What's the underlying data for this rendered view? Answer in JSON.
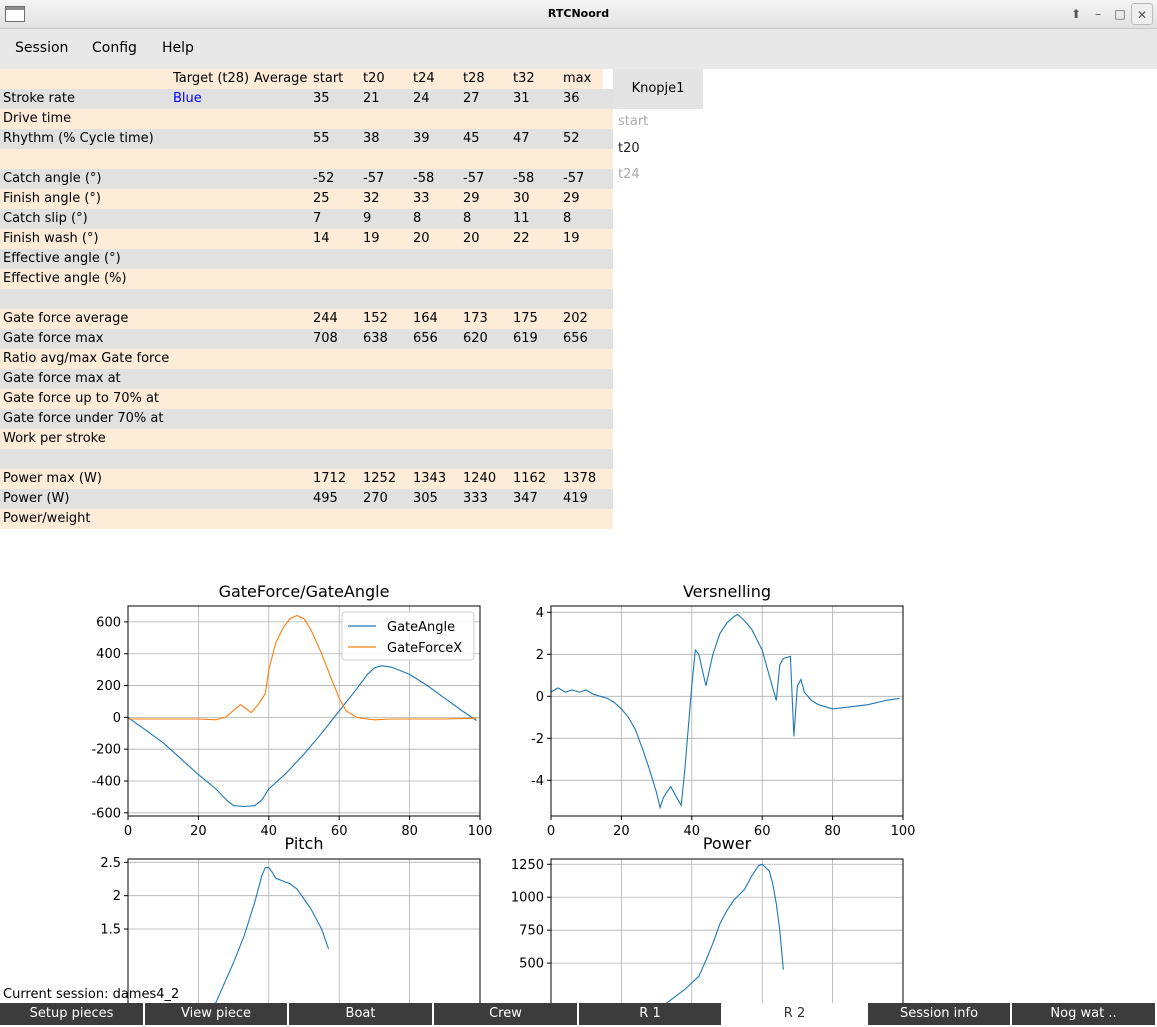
{
  "window": {
    "title": "RTCNoord"
  },
  "menu": [
    "Session",
    "Config",
    "Help"
  ],
  "table": {
    "header": {
      "target": "Target (t28)",
      "average": "Average",
      "cols": [
        "start",
        "t20",
        "t24",
        "t28",
        "t32",
        "max"
      ]
    },
    "rows": [
      {
        "label": "Stroke rate",
        "target": "Blue",
        "values": [
          "35",
          "21",
          "24",
          "27",
          "31",
          "36"
        ]
      },
      {
        "label": "Drive time",
        "target": "",
        "values": []
      },
      {
        "label": "Rhythm (% Cycle time)",
        "target": "",
        "values": [
          "55",
          "38",
          "39",
          "45",
          "47",
          "52"
        ]
      },
      {
        "label": "",
        "target": "",
        "values": []
      },
      {
        "label": "Catch angle (°)",
        "target": "",
        "values": [
          "-52",
          "-57",
          "-58",
          "-57",
          "-58",
          "-57"
        ]
      },
      {
        "label": "Finish angle (°)",
        "target": "",
        "values": [
          "25",
          "32",
          "33",
          "29",
          "30",
          "29"
        ]
      },
      {
        "label": "Catch slip (°)",
        "target": "",
        "values": [
          "7",
          "9",
          "8",
          "8",
          "11",
          "8"
        ]
      },
      {
        "label": "Finish wash (°)",
        "target": "",
        "values": [
          "14",
          "19",
          "20",
          "20",
          "22",
          "19"
        ]
      },
      {
        "label": "Effective angle (°)",
        "target": "",
        "values": []
      },
      {
        "label": "Effective angle (%)",
        "target": "",
        "values": []
      },
      {
        "label": "",
        "target": "",
        "values": []
      },
      {
        "label": "Gate force average",
        "target": "",
        "values": [
          "244",
          "152",
          "164",
          "173",
          "175",
          "202"
        ]
      },
      {
        "label": "Gate force max",
        "target": "",
        "values": [
          "708",
          "638",
          "656",
          "620",
          "619",
          "656"
        ]
      },
      {
        "label": "Ratio avg/max Gate force",
        "target": "",
        "values": []
      },
      {
        "label": "Gate force max at",
        "target": "",
        "values": []
      },
      {
        "label": "Gate force up to 70% at",
        "target": "",
        "values": []
      },
      {
        "label": "Gate force under 70% at",
        "target": "",
        "values": []
      },
      {
        "label": "Work per stroke",
        "target": "",
        "values": []
      },
      {
        "label": "",
        "target": "",
        "values": []
      },
      {
        "label": "Power max (W)",
        "target": "",
        "values": [
          "1712",
          "1252",
          "1343",
          "1240",
          "1162",
          "1378"
        ]
      },
      {
        "label": "Power (W)",
        "target": "",
        "values": [
          "495",
          "270",
          "305",
          "333",
          "347",
          "419"
        ]
      },
      {
        "label": "Power/weight",
        "target": "",
        "values": []
      }
    ]
  },
  "side": {
    "button": "Knopje1",
    "items": [
      "start",
      "t20",
      "t24"
    ],
    "selected": 1
  },
  "chart_data": [
    {
      "type": "line",
      "title": "GateForce/GateAngle",
      "xlim": [
        0,
        100
      ],
      "ylim": [
        -620,
        700
      ],
      "xticks": [
        0,
        20,
        40,
        60,
        80,
        100
      ],
      "yticks": [
        -600,
        -400,
        -200,
        0,
        200,
        400,
        600
      ],
      "grid": true,
      "legend": "top-right",
      "series": [
        {
          "name": "GateAngle",
          "color": "#1f77b4",
          "x": [
            0,
            5,
            10,
            15,
            20,
            25,
            28,
            30,
            33,
            36,
            38,
            40,
            45,
            50,
            55,
            60,
            65,
            68,
            70,
            72,
            75,
            80,
            85,
            90,
            95,
            99
          ],
          "y": [
            0,
            -80,
            -160,
            -260,
            -360,
            -450,
            -520,
            -555,
            -560,
            -555,
            -520,
            -450,
            -350,
            -230,
            -100,
            40,
            180,
            270,
            310,
            325,
            315,
            270,
            200,
            120,
            40,
            -20
          ]
        },
        {
          "name": "GateForceX",
          "color": "#ff7f0e",
          "x": [
            0,
            10,
            20,
            25,
            28,
            30,
            32,
            35,
            37,
            39,
            40,
            42,
            44,
            46,
            48,
            50,
            52,
            55,
            58,
            60,
            62,
            65,
            68,
            70,
            75,
            80,
            90,
            99
          ],
          "y": [
            -10,
            -10,
            -10,
            -15,
            5,
            45,
            80,
            30,
            80,
            150,
            300,
            470,
            560,
            620,
            640,
            620,
            550,
            400,
            230,
            120,
            40,
            0,
            -10,
            -15,
            -10,
            -10,
            -10,
            -5
          ]
        }
      ]
    },
    {
      "type": "line",
      "title": "Versnelling",
      "xlim": [
        0,
        100
      ],
      "ylim": [
        -5.7,
        4.3
      ],
      "xticks": [
        0,
        20,
        40,
        60,
        80,
        100
      ],
      "yticks": [
        -4,
        -2,
        0,
        2,
        4
      ],
      "grid": true,
      "series": [
        {
          "name": "",
          "color": "#1f77b4",
          "x": [
            0,
            2,
            4,
            6,
            8,
            10,
            12,
            14,
            16,
            18,
            20,
            22,
            24,
            26,
            28,
            30,
            31,
            32,
            34,
            36,
            37,
            38,
            40,
            41,
            42,
            44,
            46,
            48,
            50,
            52,
            53,
            55,
            57,
            60,
            62,
            64,
            65,
            66,
            68,
            69,
            70,
            71,
            72,
            74,
            76,
            78,
            80,
            85,
            90,
            95,
            99
          ],
          "y": [
            0.2,
            0.4,
            0.2,
            0.3,
            0.2,
            0.3,
            0.1,
            0.0,
            -0.1,
            -0.3,
            -0.6,
            -1.0,
            -1.6,
            -2.5,
            -3.5,
            -4.6,
            -5.3,
            -4.8,
            -4.3,
            -4.9,
            -5.2,
            -3.5,
            0.5,
            2.2,
            2.0,
            0.5,
            2.0,
            3.0,
            3.5,
            3.8,
            3.9,
            3.6,
            3.2,
            2.2,
            1.0,
            -0.2,
            1.5,
            1.8,
            1.9,
            -1.9,
            0.5,
            0.8,
            0.2,
            -0.2,
            -0.4,
            -0.5,
            -0.6,
            -0.5,
            -0.4,
            -0.2,
            -0.1
          ]
        }
      ]
    },
    {
      "type": "line",
      "title": "Pitch",
      "xlim": [
        0,
        100
      ],
      "ylim": [
        0.0,
        2.55
      ],
      "yticks": [
        1.5,
        2.0,
        2.5
      ],
      "grid": true,
      "series": [
        {
          "name": "",
          "color": "#1f77b4",
          "x": [
            20,
            25,
            30,
            33,
            36,
            38,
            39,
            40,
            41,
            42,
            44,
            46,
            48,
            50,
            52,
            55,
            57
          ],
          "y": [
            0.0,
            0.4,
            1.0,
            1.4,
            1.9,
            2.3,
            2.42,
            2.42,
            2.35,
            2.26,
            2.22,
            2.18,
            2.1,
            1.95,
            1.8,
            1.5,
            1.2
          ]
        }
      ]
    },
    {
      "type": "line",
      "title": "Power",
      "xlim": [
        0,
        100
      ],
      "ylim": [
        0,
        1290
      ],
      "yticks": [
        500,
        750,
        1000,
        1250
      ],
      "grid": true,
      "series": [
        {
          "name": "",
          "color": "#1f77b4",
          "x": [
            30,
            33,
            38,
            40,
            42,
            44,
            46,
            48,
            50,
            52,
            55,
            57,
            59,
            60,
            62,
            63,
            64,
            65,
            66
          ],
          "y": [
            0,
            200,
            300,
            350,
            400,
            520,
            650,
            800,
            900,
            980,
            1060,
            1160,
            1240,
            1250,
            1200,
            1100,
            950,
            750,
            450
          ]
        }
      ]
    }
  ],
  "footer": {
    "session": "Current session:  dames4_2"
  },
  "tabs": [
    "Setup pieces",
    "View piece",
    "Boat",
    "Crew",
    "R 1",
    "R 2",
    "Session info",
    "Nog wat .."
  ],
  "active_tab": 5
}
